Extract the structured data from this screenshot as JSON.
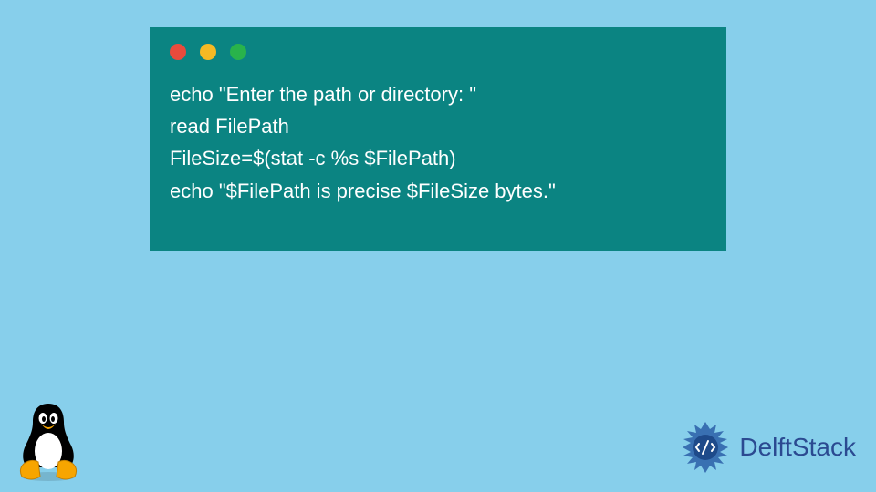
{
  "code": {
    "line1": "echo \"Enter the path or directory: \"",
    "line2": "read FilePath",
    "line3": "FileSize=$(stat -c %s $FilePath)",
    "line4": "echo \"$FilePath is precise $FileSize bytes.\""
  },
  "brand": "DelftStack",
  "colors": {
    "bg": "#87cfeb",
    "terminal": "#0b8482",
    "brand": "#2b4a91"
  }
}
